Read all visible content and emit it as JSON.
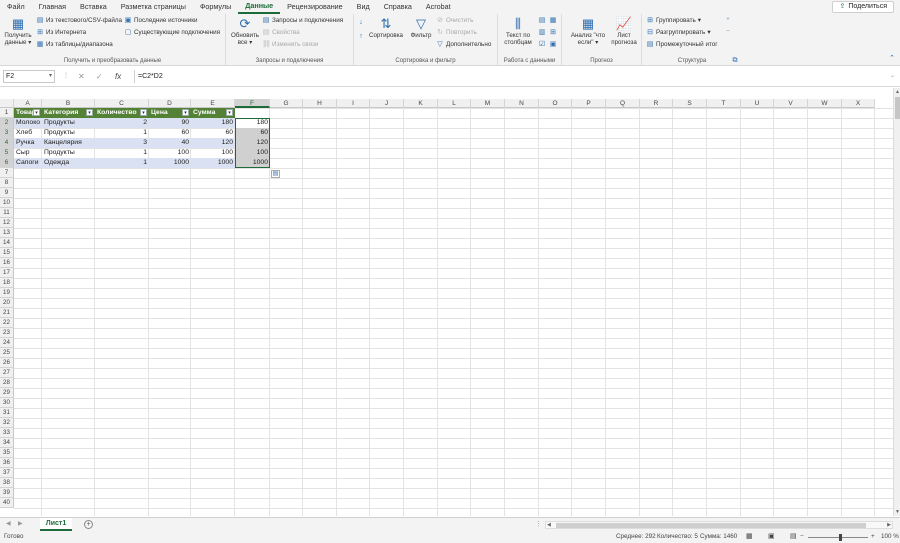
{
  "menu": {
    "tabs": [
      "Файл",
      "Главная",
      "Вставка",
      "Разметка страницы",
      "Формулы",
      "Данные",
      "Рецензирование",
      "Вид",
      "Справка",
      "Acrobat"
    ],
    "active_index": 5,
    "share_label": "Поделиться"
  },
  "ribbon": {
    "group1": {
      "label": "Получить и преобразовать данные",
      "get_data": "Получить данные",
      "from_csv": "Из текстового/CSV-файла",
      "from_web": "Из Интернета",
      "from_table": "Из таблицы/диапазона",
      "recent_sources": "Последние источники",
      "existing_connections": "Существующие подключения"
    },
    "group2": {
      "label": "Запросы и подключения",
      "refresh_all": "Обновить все",
      "queries": "Запросы и подключения",
      "properties": "Свойства",
      "edit_links": "Изменить связи"
    },
    "group3": {
      "label": "Сортировка и фильтр",
      "sort": "Сортировка",
      "filter": "Фильтр",
      "clear": "Очистить",
      "reapply": "Повторить",
      "advanced": "Дополнительно"
    },
    "group4": {
      "label": "Работа с данными",
      "text_to_columns": "Текст по столбцам"
    },
    "group5": {
      "label": "Прогноз",
      "what_if": "Анализ \"что если\"",
      "forecast_sheet": "Лист прогноза"
    },
    "group6": {
      "label": "Структура",
      "group": "Группировать",
      "ungroup": "Разгруппировать",
      "subtotal": "Промежуточный итог"
    }
  },
  "formula_bar": {
    "name_box": "F2",
    "formula": "=C2*D2",
    "cancel": "✕",
    "enter": "✓",
    "fx": "fx"
  },
  "grid": {
    "columns": [
      "A",
      "B",
      "C",
      "D",
      "E",
      "F",
      "G",
      "H",
      "I",
      "J",
      "K",
      "L",
      "M",
      "N",
      "O",
      "P",
      "Q",
      "R",
      "S",
      "T",
      "U",
      "V",
      "W",
      "X"
    ],
    "row_count": 40,
    "selected_column": "F",
    "table_header": [
      "Товар",
      "Категория",
      "Количество",
      "Цена",
      "Сумма"
    ],
    "rows": [
      [
        "Молоко",
        "Продукты",
        "2",
        "90",
        "180",
        "180"
      ],
      [
        "Хлеб",
        "Продукты",
        "1",
        "60",
        "60",
        "60"
      ],
      [
        "Ручка",
        "Канцелярия",
        "3",
        "40",
        "120",
        "120"
      ],
      [
        "Сыр",
        "Продукты",
        "1",
        "100",
        "100",
        "100"
      ],
      [
        "Сапоги",
        "Одежда",
        "1",
        "1000",
        "1000",
        "1000"
      ]
    ]
  },
  "sheets": {
    "active": "Лист1"
  },
  "status": {
    "ready": "Готово",
    "average": "Среднее: 292",
    "count": "Количество: 5",
    "sum": "Сумма: 1460",
    "zoom": "100 %"
  }
}
